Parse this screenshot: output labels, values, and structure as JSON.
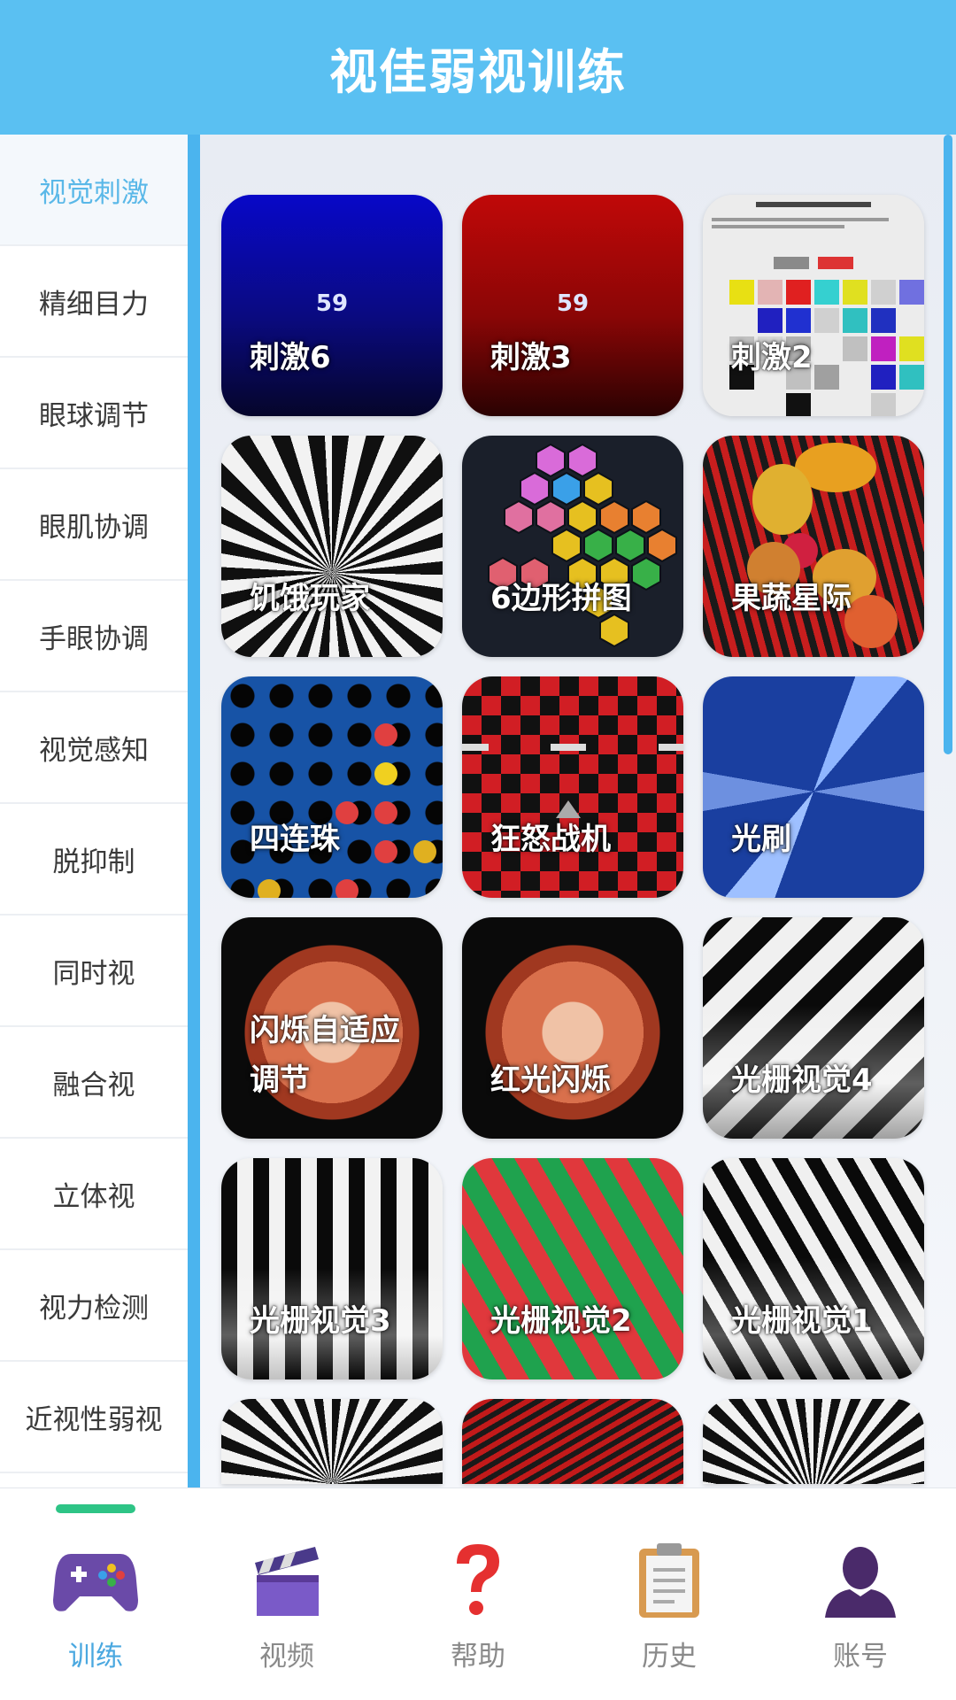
{
  "header": {
    "title": "视佳弱视训练"
  },
  "sidebar": {
    "items": [
      {
        "label": "视觉刺激",
        "active": true
      },
      {
        "label": "精细目力"
      },
      {
        "label": "眼球调节"
      },
      {
        "label": "眼肌协调"
      },
      {
        "label": "手眼协调"
      },
      {
        "label": "视觉感知"
      },
      {
        "label": "脱抑制"
      },
      {
        "label": "同时视"
      },
      {
        "label": "融合视"
      },
      {
        "label": "立体视"
      },
      {
        "label": "视力检测"
      },
      {
        "label": "近视性弱视"
      }
    ]
  },
  "cards": [
    {
      "label": "刺激6",
      "number": "59"
    },
    {
      "label": "刺激3",
      "number": "59"
    },
    {
      "label": "刺激2"
    },
    {
      "label": "饥饿玩家"
    },
    {
      "label": "6边形拼图"
    },
    {
      "label": "果蔬星际"
    },
    {
      "label": "四连珠"
    },
    {
      "label": "狂怒战机"
    },
    {
      "label": "光刷"
    },
    {
      "label": "闪烁自适应调节"
    },
    {
      "label": "红光闪烁"
    },
    {
      "label": "光栅视觉4"
    },
    {
      "label": "光栅视觉3"
    },
    {
      "label": "光栅视觉2"
    },
    {
      "label": "光栅视觉1"
    }
  ],
  "tabbar": {
    "tabs": [
      {
        "label": "训练",
        "icon": "gamepad-icon",
        "active": true
      },
      {
        "label": "视频",
        "icon": "clapperboard-icon"
      },
      {
        "label": "帮助",
        "icon": "question-mark-icon"
      },
      {
        "label": "历史",
        "icon": "clipboard-icon"
      },
      {
        "label": "账号",
        "icon": "user-icon"
      }
    ]
  },
  "colors": {
    "header_bg": "#5ac0f2",
    "accent": "#4bb4ee",
    "active_text": "#5ab8e8",
    "tab_indicator": "#2ec486"
  }
}
